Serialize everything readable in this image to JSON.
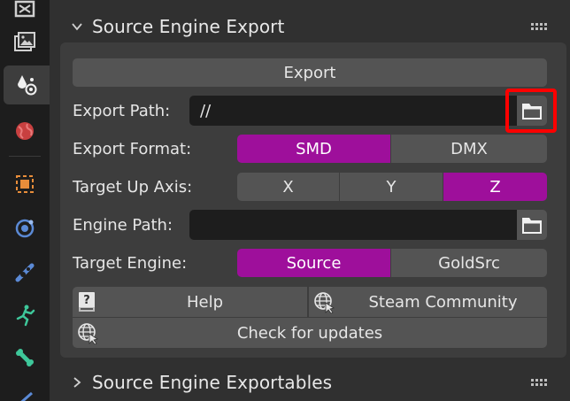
{
  "sidebar": {
    "tabs": [
      {
        "icon": "render-output-icon"
      },
      {
        "icon": "image-output-icon"
      },
      {
        "icon": "scene-icon",
        "active": true
      },
      {
        "icon": "world-icon"
      },
      {
        "icon": "object-icon"
      },
      {
        "icon": "modifier-icon"
      },
      {
        "icon": "particles-icon"
      },
      {
        "icon": "physics-icon"
      },
      {
        "icon": "bone-icon"
      },
      {
        "icon": "constraint-icon"
      }
    ]
  },
  "panels": {
    "export_panel_title": "Source Engine Export",
    "exportables_panel_title": "Source Engine Exportables"
  },
  "export": {
    "export_button": "Export",
    "export_path_label": "Export Path:",
    "export_path_value": "//",
    "export_format_label": "Export Format:",
    "export_format_options": [
      "SMD",
      "DMX"
    ],
    "export_format_selected": "SMD",
    "up_axis_label": "Target Up Axis:",
    "up_axis_options": [
      "X",
      "Y",
      "Z"
    ],
    "up_axis_selected": "Z",
    "engine_path_label": "Engine Path:",
    "engine_path_value": "",
    "target_engine_label": "Target Engine:",
    "target_engine_options": [
      "Source",
      "GoldSrc"
    ],
    "target_engine_selected": "Source",
    "help_button": "Help",
    "steam_community_button": "Steam Community",
    "check_updates_button": "Check for updates"
  },
  "colors": {
    "accent_selected": "#9e0f9b",
    "highlight_box": "#ff0000",
    "panel_bg": "#3d3d3d",
    "field_bg": "#1d1d1d",
    "button_bg": "#545454"
  }
}
